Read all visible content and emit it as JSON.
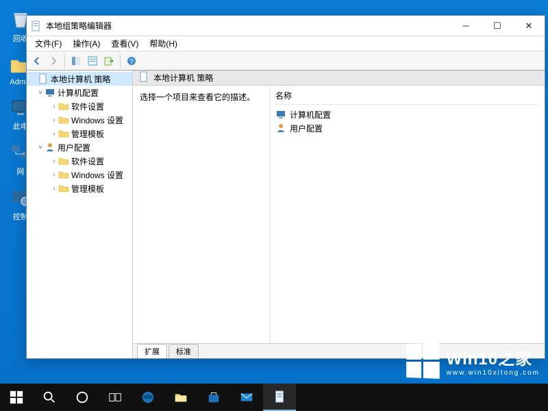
{
  "desktop": {
    "recycle_label": "回收",
    "admin_label": "Admin",
    "this_pc_label": "此电",
    "network_label": "网",
    "control_label": "控制"
  },
  "window": {
    "title": "本地组策略编辑器",
    "menu": {
      "file": "文件(F)",
      "action": "操作(A)",
      "view": "查看(V)",
      "help": "帮助(H)"
    }
  },
  "tree": {
    "root": "本地计算机 策略",
    "computer_config": "计算机配置",
    "software_settings": "软件设置",
    "windows_settings": "Windows 设置",
    "admin_templates": "管理模板",
    "user_config": "用户配置"
  },
  "content": {
    "header": "本地计算机 策略",
    "description_hint": "选择一个项目来查看它的描述。",
    "col_name": "名称",
    "items": {
      "computer_config": "计算机配置",
      "user_config": "用户配置"
    },
    "tab_extended": "扩展",
    "tab_standard": "标准"
  },
  "watermark": {
    "brand": "Win10之家",
    "url": "www.win10xitong.com"
  }
}
